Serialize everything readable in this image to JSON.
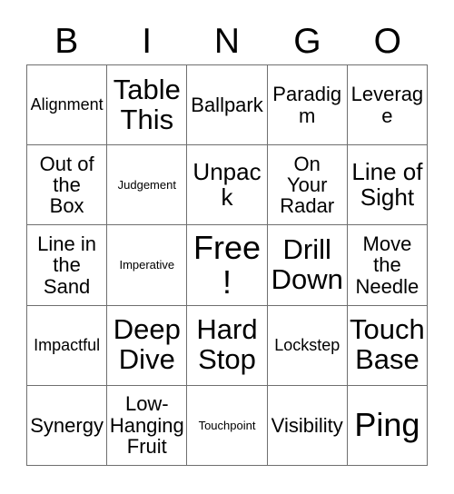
{
  "card": {
    "title": "BINGO",
    "header_letters": [
      "B",
      "I",
      "N",
      "G",
      "O"
    ],
    "colors": {
      "background": "#ffffff",
      "text": "#000000",
      "border": "#6f6f6f"
    },
    "rows": [
      [
        {
          "label": "Alignment",
          "size": "s"
        },
        {
          "label": "Table\nThis",
          "size": "xl"
        },
        {
          "label": "Ballpark",
          "size": "m"
        },
        {
          "label": "Paradigm",
          "size": "m"
        },
        {
          "label": "Leverage",
          "size": "m"
        }
      ],
      [
        {
          "label": "Out of\nthe\nBox",
          "size": "m"
        },
        {
          "label": "Judgement",
          "size": "xs"
        },
        {
          "label": "Unpack",
          "size": "l"
        },
        {
          "label": "On\nYour\nRadar",
          "size": "m"
        },
        {
          "label": "Line of\nSight",
          "size": "l"
        }
      ],
      [
        {
          "label": "Line in\nthe\nSand",
          "size": "m"
        },
        {
          "label": "Imperative",
          "size": "xs"
        },
        {
          "label": "Free!",
          "size": "xxl"
        },
        {
          "label": "Drill\nDown",
          "size": "xl"
        },
        {
          "label": "Move\nthe\nNeedle",
          "size": "m"
        }
      ],
      [
        {
          "label": "Impactful",
          "size": "s"
        },
        {
          "label": "Deep\nDive",
          "size": "xl"
        },
        {
          "label": "Hard\nStop",
          "size": "xl"
        },
        {
          "label": "Lockstep",
          "size": "s"
        },
        {
          "label": "Touch\nBase",
          "size": "xl"
        }
      ],
      [
        {
          "label": "Synergy",
          "size": "m"
        },
        {
          "label": "Low-\nHanging\nFruit",
          "size": "m"
        },
        {
          "label": "Touchpoint",
          "size": "xs"
        },
        {
          "label": "Visibility",
          "size": "m"
        },
        {
          "label": "Ping",
          "size": "xxl"
        }
      ]
    ]
  }
}
